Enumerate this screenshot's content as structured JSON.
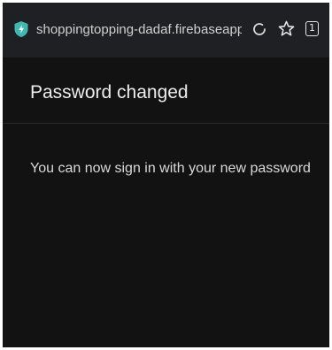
{
  "browser": {
    "url": "shoppingtopping-dadaf.firebaseapp.co",
    "tab_count": "1",
    "icons": {
      "site": "shield-icon",
      "reload": "reload-icon",
      "bookmark": "star-icon",
      "tabs": "tabs-icon"
    },
    "accent_color": "#3fb8af"
  },
  "dialog": {
    "title": "Password changed",
    "message": "You can now sign in with your new password"
  }
}
